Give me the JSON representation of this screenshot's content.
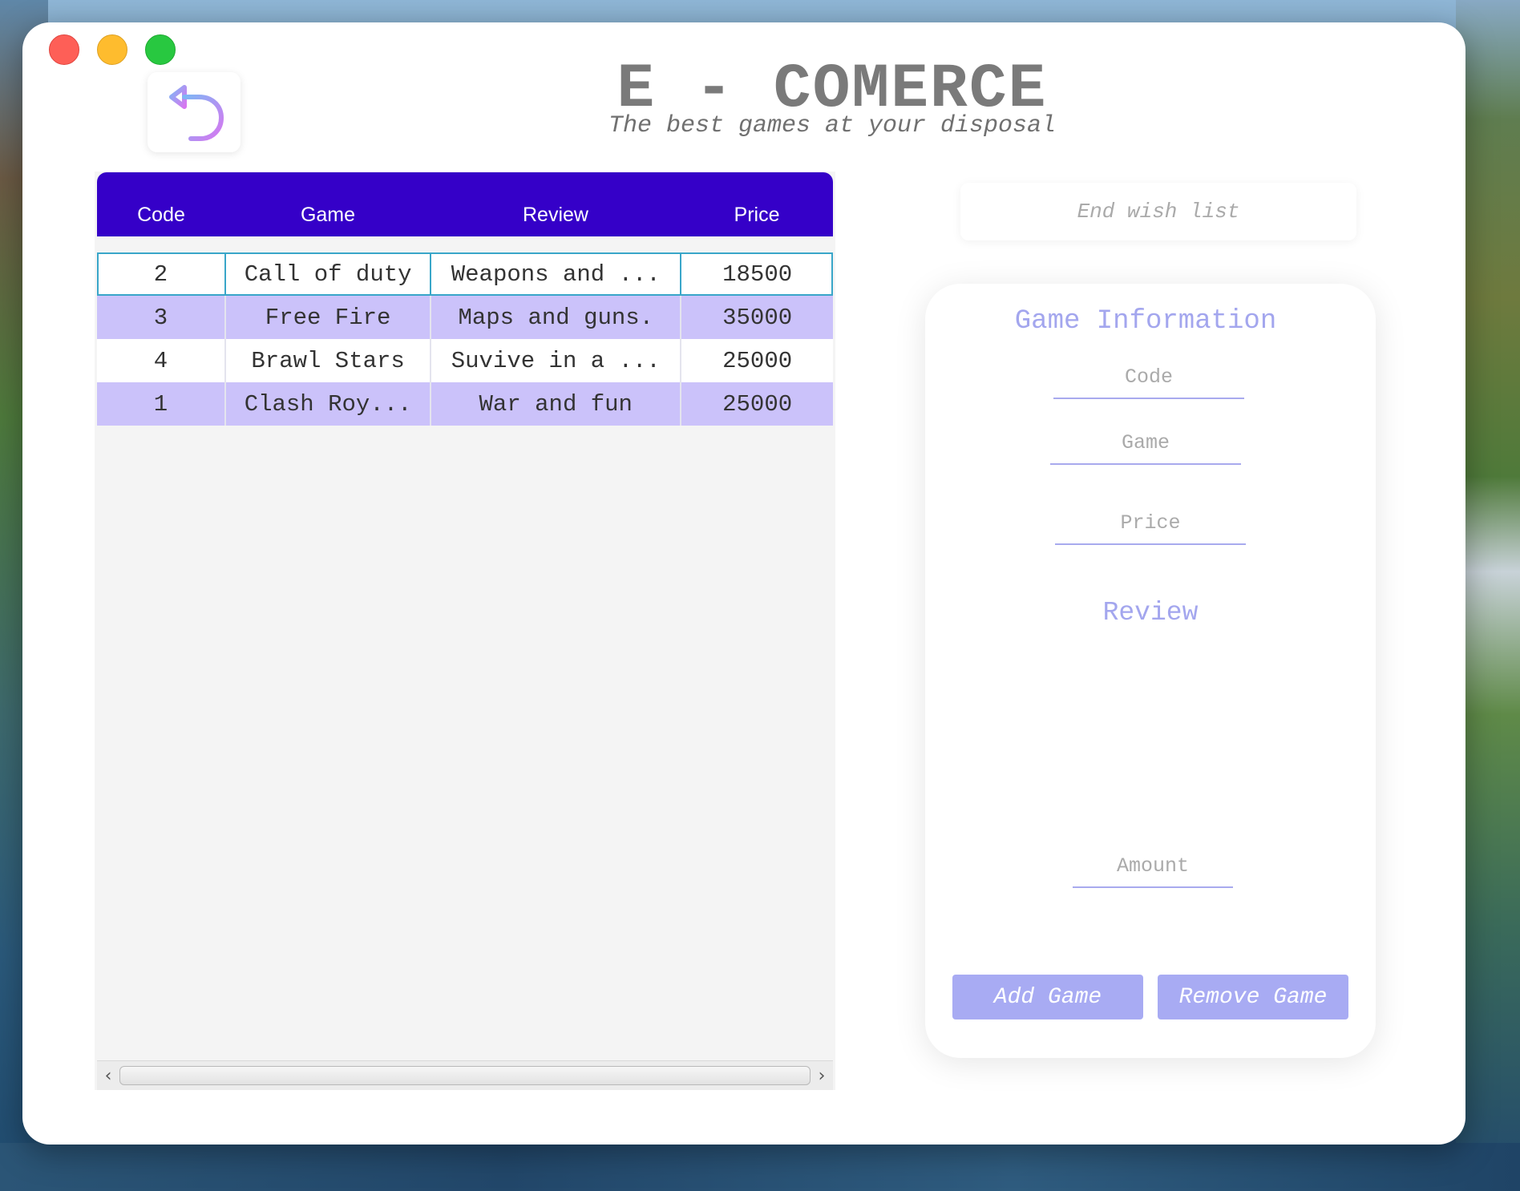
{
  "window": {
    "title": "E - COMERCE",
    "subtitle": "The best games at your disposal"
  },
  "icons": {
    "back": "undo-arrow-icon"
  },
  "table": {
    "columns": [
      "Code",
      "Game",
      "Review",
      "Price"
    ],
    "rows": [
      {
        "code": "2",
        "game": "Call of duty",
        "review": "Weapons and ...",
        "price": "18500"
      },
      {
        "code": "3",
        "game": "Free Fire",
        "review": "Maps and guns.",
        "price": "35000"
      },
      {
        "code": "4",
        "game": "Brawl Stars",
        "review": "Suvive in a ...",
        "price": "25000"
      },
      {
        "code": "1",
        "game": "Clash Roy...",
        "review": "War and fun",
        "price": "25000"
      }
    ],
    "selected_row": 0
  },
  "wishlist": {
    "label": "End wish list"
  },
  "form": {
    "title": "Game Information",
    "code_placeholder": "Code",
    "game_placeholder": "Game",
    "price_placeholder": "Price",
    "review_label": "Review",
    "amount_placeholder": "Amount",
    "add_label": "Add Game",
    "remove_label": "Remove Game"
  },
  "colors": {
    "header": "#3500c8",
    "row_alt": "#cbc2fa",
    "accent": "#a8abf3",
    "selection": "#39a6c9"
  }
}
